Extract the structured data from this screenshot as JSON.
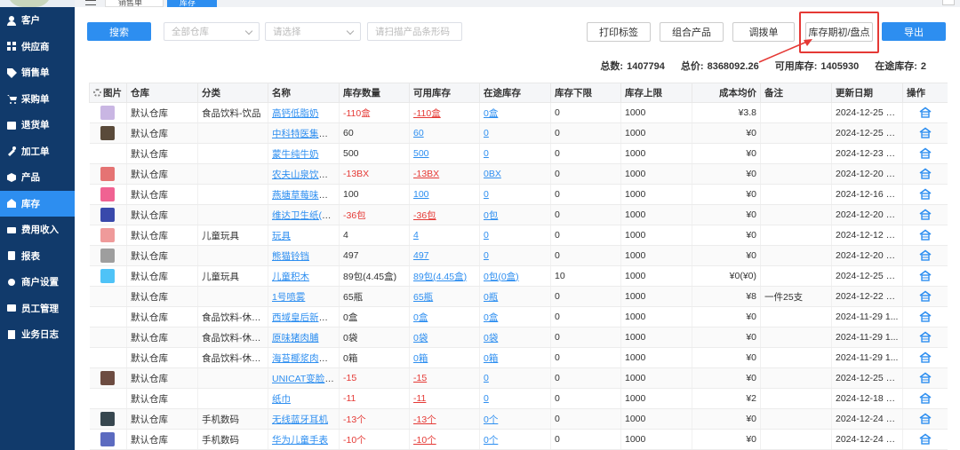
{
  "sidebar": {
    "items": [
      {
        "label": "客户",
        "icon": "user-icon"
      },
      {
        "label": "供应商",
        "icon": "supplier-icon"
      },
      {
        "label": "销售单",
        "icon": "tag-icon"
      },
      {
        "label": "采购单",
        "icon": "cart-icon"
      },
      {
        "label": "退货单",
        "icon": "return-icon"
      },
      {
        "label": "加工单",
        "icon": "tool-icon"
      },
      {
        "label": "产品",
        "icon": "box-icon"
      },
      {
        "label": "库存",
        "icon": "warehouse-icon",
        "active": true
      },
      {
        "label": "费用收入",
        "icon": "money-icon"
      },
      {
        "label": "报表",
        "icon": "report-icon"
      },
      {
        "label": "商户设置",
        "icon": "settings-icon"
      },
      {
        "label": "员工管理",
        "icon": "staff-icon"
      },
      {
        "label": "业务日志",
        "icon": "log-icon"
      }
    ]
  },
  "tabs": {
    "tab1": "销售单",
    "tab2": "库存"
  },
  "toolbar": {
    "search_label": "搜索",
    "warehouse_placeholder": "全部仓库",
    "category_placeholder": "请选择",
    "barcode_placeholder": "请扫描产品条形码",
    "print_label": "打印标签",
    "combo_label": "组合产品",
    "transfer_label": "调拨单",
    "inventory_label": "库存期初/盘点",
    "export_label": "导出"
  },
  "totals": {
    "count_label": "总数:",
    "count_value": "1407794",
    "price_label": "总价:",
    "price_value": "8368092.26",
    "available_label": "可用库存:",
    "available_value": "1405930",
    "transit_label": "在途库存:",
    "transit_value": "2"
  },
  "table": {
    "headers": [
      "图片",
      "仓库",
      "分类",
      "名称",
      "库存数量",
      "可用库存",
      "在途库存",
      "库存下限",
      "库存上限",
      "成本均价",
      "备注",
      "更新日期",
      "操作"
    ],
    "rows": [
      {
        "thumb": "#c9b6e3",
        "warehouse": "默认仓库",
        "category": "食品饮料-饮品",
        "name": "高钙低脂奶",
        "qty": "-110盒",
        "avail": "-110盒",
        "transit": "0盒",
        "min": "0",
        "max": "1000",
        "cost": "¥3.8",
        "note": "",
        "date": "2024-12-25 1..."
      },
      {
        "thumb": "#5a4a3a",
        "warehouse": "默认仓库",
        "category": "",
        "name": "中科特医集团东...",
        "qty": "60",
        "avail": "60",
        "transit": "0",
        "min": "0",
        "max": "1000",
        "cost": "¥0",
        "note": "",
        "date": "2024-12-25 1..."
      },
      {
        "thumb": "",
        "warehouse": "默认仓库",
        "category": "",
        "name": "蒙牛纯牛奶",
        "qty": "500",
        "avail": "500",
        "transit": "0",
        "min": "0",
        "max": "1000",
        "cost": "¥0",
        "note": "",
        "date": "2024-12-23 1..."
      },
      {
        "thumb": "#e57373",
        "warehouse": "默认仓库",
        "category": "",
        "name": "农夫山泉饮用天...",
        "qty": "-13BX",
        "avail": "-13BX",
        "transit": "0BX",
        "min": "0",
        "max": "1000",
        "cost": "¥0",
        "note": "",
        "date": "2024-12-20 1..."
      },
      {
        "thumb": "#f06292",
        "warehouse": "默认仓库",
        "category": "",
        "name": "燕塘草莓味酸奶...",
        "qty": "100",
        "avail": "100",
        "transit": "0",
        "min": "0",
        "max": "1000",
        "cost": "¥0",
        "note": "",
        "date": "2024-12-16 1..."
      },
      {
        "thumb": "#3949ab",
        "warehouse": "默认仓库",
        "category": "",
        "name": "维达卫生纸(Tya...",
        "qty": "-36包",
        "avail": "-36包",
        "transit": "0包",
        "min": "0",
        "max": "1000",
        "cost": "¥0",
        "note": "",
        "date": "2024-12-20 1..."
      },
      {
        "thumb": "#ef9a9a",
        "warehouse": "默认仓库",
        "category": "儿童玩具",
        "name": "玩具",
        "qty": "4",
        "avail": "4",
        "transit": "0",
        "min": "0",
        "max": "1000",
        "cost": "¥0",
        "note": "",
        "date": "2024-12-12 1..."
      },
      {
        "thumb": "#9e9e9e",
        "warehouse": "默认仓库",
        "category": "",
        "name": "熊猫铃铛",
        "qty": "497",
        "avail": "497",
        "transit": "0",
        "min": "0",
        "max": "1000",
        "cost": "¥0",
        "note": "",
        "date": "2024-12-20 1..."
      },
      {
        "thumb": "#4fc3f7",
        "warehouse": "默认仓库",
        "category": "儿童玩具",
        "name": "儿童积木",
        "qty": "89包(4.45盒)",
        "avail": "89包(4.45盒)",
        "transit": "0包(0盒)",
        "min": "10",
        "max": "1000",
        "cost": "¥0(¥0)",
        "note": "",
        "date": "2024-12-25 1..."
      },
      {
        "thumb": "",
        "warehouse": "默认仓库",
        "category": "",
        "name": "1号喷雾",
        "qty": "65瓶",
        "avail": "65瓶",
        "transit": "0瓶",
        "min": "0",
        "max": "1000",
        "cost": "¥8",
        "note": "一件25支",
        "date": "2024-12-22 0..."
      },
      {
        "thumb": "",
        "warehouse": "默认仓库",
        "category": "食品饮料-休闲...",
        "name": "西域皇后新疆烤...",
        "qty": "0盒",
        "avail": "0盒",
        "transit": "0盒",
        "min": "0",
        "max": "1000",
        "cost": "¥0",
        "note": "",
        "date": "2024-11-29 1..."
      },
      {
        "thumb": "",
        "warehouse": "默认仓库",
        "category": "食品饮料-休闲...",
        "name": "原味猪肉脯",
        "qty": "0袋",
        "avail": "0袋",
        "transit": "0袋",
        "min": "0",
        "max": "1000",
        "cost": "¥0",
        "note": "",
        "date": "2024-11-29 1..."
      },
      {
        "thumb": "",
        "warehouse": "默认仓库",
        "category": "食品饮料-休闲...",
        "name": "海苔椰浆肉松小...",
        "qty": "0箱",
        "avail": "0箱",
        "transit": "0箱",
        "min": "0",
        "max": "1000",
        "cost": "¥0",
        "note": "",
        "date": "2024-11-29 1..."
      },
      {
        "thumb": "#6d4c41",
        "warehouse": "默认仓库",
        "category": "",
        "name": "UNICAT变脸猫...",
        "qty": "-15",
        "avail": "-15",
        "transit": "0",
        "min": "0",
        "max": "1000",
        "cost": "¥0",
        "note": "",
        "date": "2024-12-25 1..."
      },
      {
        "thumb": "",
        "warehouse": "默认仓库",
        "category": "",
        "name": "纸巾",
        "qty": "-11",
        "avail": "-11",
        "transit": "0",
        "min": "0",
        "max": "1000",
        "cost": "¥2",
        "note": "",
        "date": "2024-12-18 1..."
      },
      {
        "thumb": "#37474f",
        "warehouse": "默认仓库",
        "category": "手机数码",
        "name": "无线蓝牙耳机",
        "qty": "-13个",
        "avail": "-13个",
        "transit": "0个",
        "min": "0",
        "max": "1000",
        "cost": "¥0",
        "note": "",
        "date": "2024-12-24 1..."
      },
      {
        "thumb": "#5c6bc0",
        "warehouse": "默认仓库",
        "category": "手机数码",
        "name": "华为儿童手表",
        "qty": "-10个",
        "avail": "-10个",
        "transit": "0个",
        "min": "0",
        "max": "1000",
        "cost": "¥0",
        "note": "",
        "date": "2024-12-24 1..."
      }
    ]
  },
  "colors": {
    "sidebar_bg": "#113a6b",
    "accent": "#2d8ef0",
    "negative": "#e53935",
    "highlight": "#e53935"
  }
}
